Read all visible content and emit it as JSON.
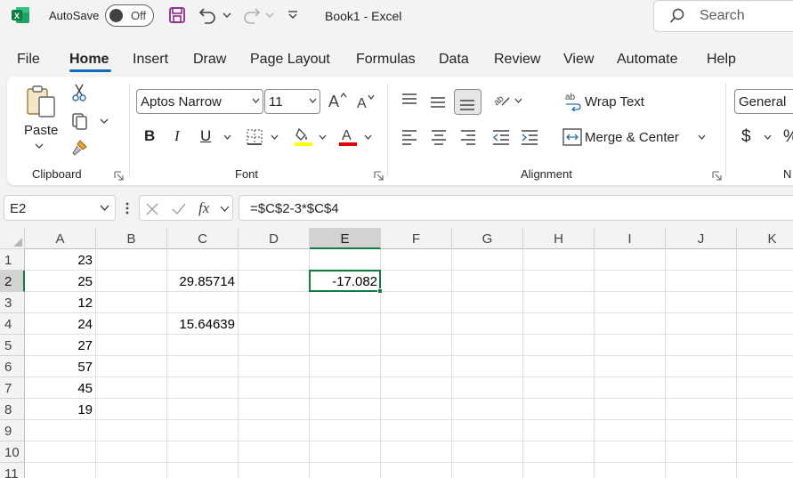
{
  "titlebar": {
    "autosave_label": "AutoSave",
    "toggle_state": "Off",
    "title": "Book1  -  Excel",
    "search_placeholder": "Search"
  },
  "tabs": [
    "File",
    "Home",
    "Insert",
    "Draw",
    "Page Layout",
    "Formulas",
    "Data",
    "Review",
    "View",
    "Automate",
    "Help"
  ],
  "active_tab": "Home",
  "ribbon": {
    "clipboard": {
      "paste_label": "Paste",
      "group_label": "Clipboard"
    },
    "font": {
      "font_name": "Aptos Narrow",
      "font_size": "11",
      "group_label": "Font",
      "bold": "B",
      "italic": "I",
      "underline": "U",
      "highlight_color": "#ffff00",
      "font_color": "#e00000"
    },
    "alignment": {
      "wrap_text": "Wrap Text",
      "merge_center": "Merge & Center",
      "group_label": "Alignment"
    },
    "number": {
      "format": "General",
      "currency": "$",
      "percent": "%",
      "group_label": "N"
    }
  },
  "formula_bar": {
    "name_box": "E2",
    "fx": "fx",
    "formula": "=$C$2-3*$C$4"
  },
  "grid": {
    "columns": [
      "A",
      "B",
      "C",
      "D",
      "E",
      "F",
      "G",
      "H",
      "I",
      "J",
      "K"
    ],
    "rows": [
      "1",
      "2",
      "3",
      "4",
      "5",
      "6",
      "7",
      "8",
      "9",
      "10",
      "11"
    ],
    "selected_column": "E",
    "selected_row": "2",
    "cells": {
      "A1": "23",
      "A2": "25",
      "A3": "12",
      "A4": "24",
      "A5": "27",
      "A6": "57",
      "A7": "45",
      "A8": "19",
      "C2": "29.85714",
      "C4": "15.64639",
      "E2": "-17.082"
    },
    "accent_color": "#107c41"
  }
}
